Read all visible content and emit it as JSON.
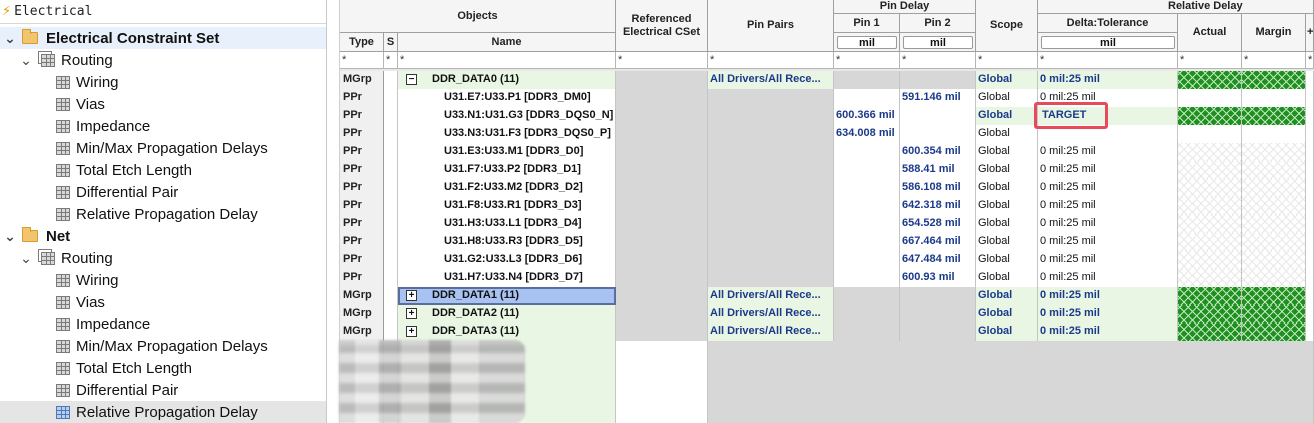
{
  "tree": {
    "title": "Electrical",
    "items": [
      {
        "label": "Electrical Constraint Set",
        "level": 0,
        "kind": "folder",
        "expanded": true,
        "bold": true,
        "state": "hl"
      },
      {
        "label": "Routing",
        "level": 1,
        "kind": "stack",
        "expanded": true
      },
      {
        "label": "Wiring",
        "level": 2,
        "kind": "sheet"
      },
      {
        "label": "Vias",
        "level": 2,
        "kind": "sheet"
      },
      {
        "label": "Impedance",
        "level": 2,
        "kind": "sheet"
      },
      {
        "label": "Min/Max Propagation Delays",
        "level": 2,
        "kind": "sheet"
      },
      {
        "label": "Total Etch Length",
        "level": 2,
        "kind": "sheet"
      },
      {
        "label": "Differential Pair",
        "level": 2,
        "kind": "sheet"
      },
      {
        "label": "Relative Propagation Delay",
        "level": 2,
        "kind": "sheet"
      },
      {
        "label": "Net",
        "level": 0,
        "kind": "folder",
        "expanded": true,
        "bold": true
      },
      {
        "label": "Routing",
        "level": 1,
        "kind": "stack",
        "expanded": true
      },
      {
        "label": "Wiring",
        "level": 2,
        "kind": "sheet"
      },
      {
        "label": "Vias",
        "level": 2,
        "kind": "sheet"
      },
      {
        "label": "Impedance",
        "level": 2,
        "kind": "sheet"
      },
      {
        "label": "Min/Max Propagation Delays",
        "level": 2,
        "kind": "sheet"
      },
      {
        "label": "Total Etch Length",
        "level": 2,
        "kind": "sheet"
      },
      {
        "label": "Differential Pair",
        "level": 2,
        "kind": "sheet"
      },
      {
        "label": "Relative Propagation Delay",
        "level": 2,
        "kind": "sheet",
        "state": "sel"
      }
    ]
  },
  "headers": {
    "objects": "Objects",
    "type": "Type",
    "s": "S",
    "name": "Name",
    "ref_cset": "Referenced Electrical CSet",
    "pin_pairs": "Pin Pairs",
    "pin_delay": "Pin Delay",
    "pin1": "Pin 1",
    "pin2": "Pin 2",
    "scope": "Scope",
    "relative_delay": "Relative Delay",
    "delta_tol": "Delta:Tolerance",
    "actual": "Actual",
    "margin": "Margin",
    "extra": "+",
    "unit_pin1": "mil",
    "unit_pin2": "mil",
    "unit_delta": "mil"
  },
  "filter": "*",
  "rows": [
    {
      "type": "MGrp",
      "name": "DDR_DATA0 (11)",
      "expander": "−",
      "pinpairs": "All Drivers/All Rece...",
      "pin1": "",
      "pin2": "",
      "scope": "Global",
      "delta": "0 mil:25 mil",
      "group": true
    },
    {
      "type": "PPr",
      "name": "U31.E7:U33.P1 [DDR3_DM0]",
      "pinpairs": "",
      "pin1": "",
      "pin2": "591.146 mil",
      "scope": "Global",
      "delta": "0 mil:25 mil"
    },
    {
      "type": "PPr",
      "name": "U33.N1:U31.G3 [DDR3_DQS0_N]",
      "pinpairs": "",
      "pin1": "600.366 mil",
      "pin2": "",
      "scope": "Global",
      "delta": "TARGET",
      "target": true
    },
    {
      "type": "PPr",
      "name": "U33.N3:U31.F3 [DDR3_DQS0_P]",
      "pinpairs": "",
      "pin1": "634.008 mil",
      "pin2": "",
      "scope": "Global",
      "delta": ""
    },
    {
      "type": "PPr",
      "name": "U31.E3:U33.M1 [DDR3_D0]",
      "pinpairs": "",
      "pin1": "",
      "pin2": "600.354 mil",
      "scope": "Global",
      "delta": "0 mil:25 mil"
    },
    {
      "type": "PPr",
      "name": "U31.F7:U33.P2 [DDR3_D1]",
      "pinpairs": "",
      "pin1": "",
      "pin2": "588.41 mil",
      "scope": "Global",
      "delta": "0 mil:25 mil"
    },
    {
      "type": "PPr",
      "name": "U31.F2:U33.M2 [DDR3_D2]",
      "pinpairs": "",
      "pin1": "",
      "pin2": "586.108 mil",
      "scope": "Global",
      "delta": "0 mil:25 mil"
    },
    {
      "type": "PPr",
      "name": "U31.F8:U33.R1 [DDR3_D3]",
      "pinpairs": "",
      "pin1": "",
      "pin2": "642.318 mil",
      "scope": "Global",
      "delta": "0 mil:25 mil"
    },
    {
      "type": "PPr",
      "name": "U31.H3:U33.L1 [DDR3_D4]",
      "pinpairs": "",
      "pin1": "",
      "pin2": "654.528 mil",
      "scope": "Global",
      "delta": "0 mil:25 mil"
    },
    {
      "type": "PPr",
      "name": "U31.H8:U33.R3 [DDR3_D5]",
      "pinpairs": "",
      "pin1": "",
      "pin2": "667.464 mil",
      "scope": "Global",
      "delta": "0 mil:25 mil"
    },
    {
      "type": "PPr",
      "name": "U31.G2:U33.L3 [DDR3_D6]",
      "pinpairs": "",
      "pin1": "",
      "pin2": "647.484 mil",
      "scope": "Global",
      "delta": "0 mil:25 mil"
    },
    {
      "type": "PPr",
      "name": "U31.H7:U33.N4 [DDR3_D7]",
      "pinpairs": "",
      "pin1": "",
      "pin2": "600.93 mil",
      "scope": "Global",
      "delta": "0 mil:25 mil"
    },
    {
      "type": "MGrp",
      "name": "DDR_DATA1 (11)",
      "expander": "+",
      "pinpairs": "All Drivers/All Rece...",
      "pin1": "",
      "pin2": "",
      "scope": "Global",
      "delta": "0 mil:25 mil",
      "group": true,
      "selected": true
    },
    {
      "type": "MGrp",
      "name": "DDR_DATA2 (11)",
      "expander": "+",
      "pinpairs": "All Drivers/All Rece...",
      "pin1": "",
      "pin2": "",
      "scope": "Global",
      "delta": "0 mil:25 mil",
      "group": true
    },
    {
      "type": "MGrp",
      "name": "DDR_DATA3 (11)",
      "expander": "+",
      "pinpairs": "All Drivers/All Rece...",
      "pin1": "",
      "pin2": "",
      "scope": "Global",
      "delta": "0 mil:25 mil",
      "group": true
    }
  ],
  "colors": {
    "value_blue": "#1b3a8a",
    "group_green": "#e9f6e4",
    "target_box": "#e84a5a",
    "hatch_green": "#1f8f1f"
  }
}
